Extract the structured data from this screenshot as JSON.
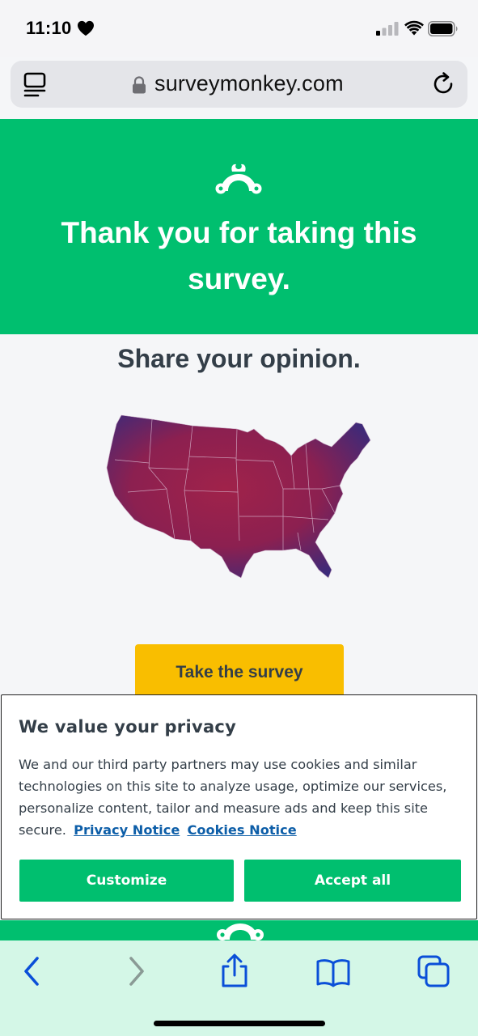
{
  "status_bar": {
    "time": "11:10",
    "icons": [
      "heart-icon",
      "cellular-signal-icon",
      "wifi-icon",
      "battery-icon"
    ]
  },
  "browser": {
    "url": "surveymonkey.com",
    "icons": [
      "reader-mode-icon",
      "lock-icon",
      "reload-icon"
    ]
  },
  "hero": {
    "title": "Thank you for taking this survey.",
    "background": "#00bf6f",
    "logo_icon": "surveymonkey-logo"
  },
  "content": {
    "heading": "Share your opinion.",
    "map_icon": "us-map-image",
    "cta_label": "Take the survey",
    "cta_color": "#f9be00"
  },
  "cookie_banner": {
    "title": "We value your privacy",
    "body": "We and our third party partners may use cookies and similar technologies on this site to analyze usage, optimize our services, personalize content, tailor and measure ads and keep this site secure.",
    "privacy_link": "Privacy Notice",
    "cookies_link": "Cookies Notice",
    "customize_label": "Customize",
    "accept_label": "Accept all",
    "button_color": "#00bf6f"
  },
  "toolbar": {
    "icons": [
      "back-icon",
      "forward-icon",
      "share-icon",
      "bookmarks-icon",
      "tabs-icon"
    ],
    "background": "#d4f7e7",
    "accent": "#0a4fd8"
  }
}
